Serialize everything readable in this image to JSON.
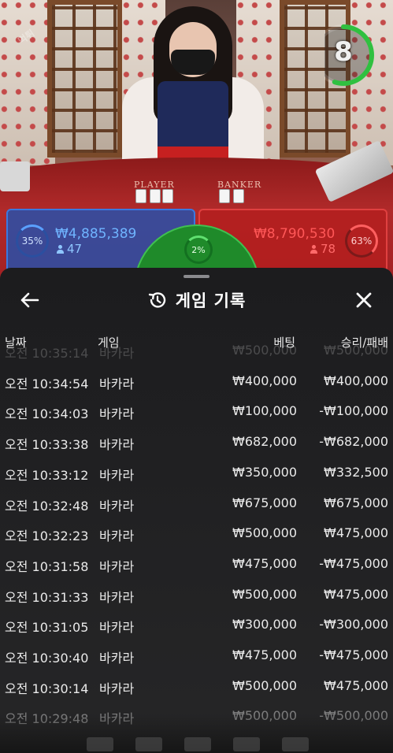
{
  "live": {
    "timer": "8",
    "player_label": "PLAYER",
    "banker_label": "BANKER",
    "player": {
      "percent": "35%",
      "amount": "₩4,885,389",
      "count": "47"
    },
    "banker": {
      "percent": "63%",
      "amount": "₩8,790,530",
      "count": "78"
    },
    "tie": {
      "percent": "2%"
    },
    "colors": {
      "player": "#3a78e0",
      "banker": "#e04040",
      "tie": "#1f8a2a"
    },
    "timer_progress": 0.55
  },
  "history": {
    "title": "게임 기록",
    "icons": {
      "back": "back-arrow-icon",
      "title": "history-icon",
      "close": "close-icon"
    },
    "columns": {
      "date": "날짜",
      "game": "게임",
      "bet": "베팅",
      "result": "승리/패배"
    },
    "rows": [
      {
        "date": "오전 10:35:14",
        "game": "바카라",
        "bet": "₩500,000",
        "result": "₩500,000"
      },
      {
        "date": "오전 10:34:54",
        "game": "바카라",
        "bet": "₩400,000",
        "result": "₩400,000"
      },
      {
        "date": "오전 10:34:03",
        "game": "바카라",
        "bet": "₩100,000",
        "result": "-₩100,000"
      },
      {
        "date": "오전 10:33:38",
        "game": "바카라",
        "bet": "₩682,000",
        "result": "-₩682,000"
      },
      {
        "date": "오전 10:33:12",
        "game": "바카라",
        "bet": "₩350,000",
        "result": "₩332,500"
      },
      {
        "date": "오전 10:32:48",
        "game": "바카라",
        "bet": "₩675,000",
        "result": "₩675,000"
      },
      {
        "date": "오전 10:32:23",
        "game": "바카라",
        "bet": "₩500,000",
        "result": "₩475,000"
      },
      {
        "date": "오전 10:31:58",
        "game": "바카라",
        "bet": "₩475,000",
        "result": "-₩475,000"
      },
      {
        "date": "오전 10:31:33",
        "game": "바카라",
        "bet": "₩500,000",
        "result": "₩475,000"
      },
      {
        "date": "오전 10:31:05",
        "game": "바카라",
        "bet": "₩300,000",
        "result": "-₩300,000"
      },
      {
        "date": "오전 10:30:40",
        "game": "바카라",
        "bet": "₩475,000",
        "result": "-₩475,000"
      },
      {
        "date": "오전 10:30:14",
        "game": "바카라",
        "bet": "₩500,000",
        "result": "₩475,000"
      },
      {
        "date": "오전 10:29:48",
        "game": "바카라",
        "bet": "₩500,000",
        "result": "-₩500,000"
      }
    ]
  }
}
